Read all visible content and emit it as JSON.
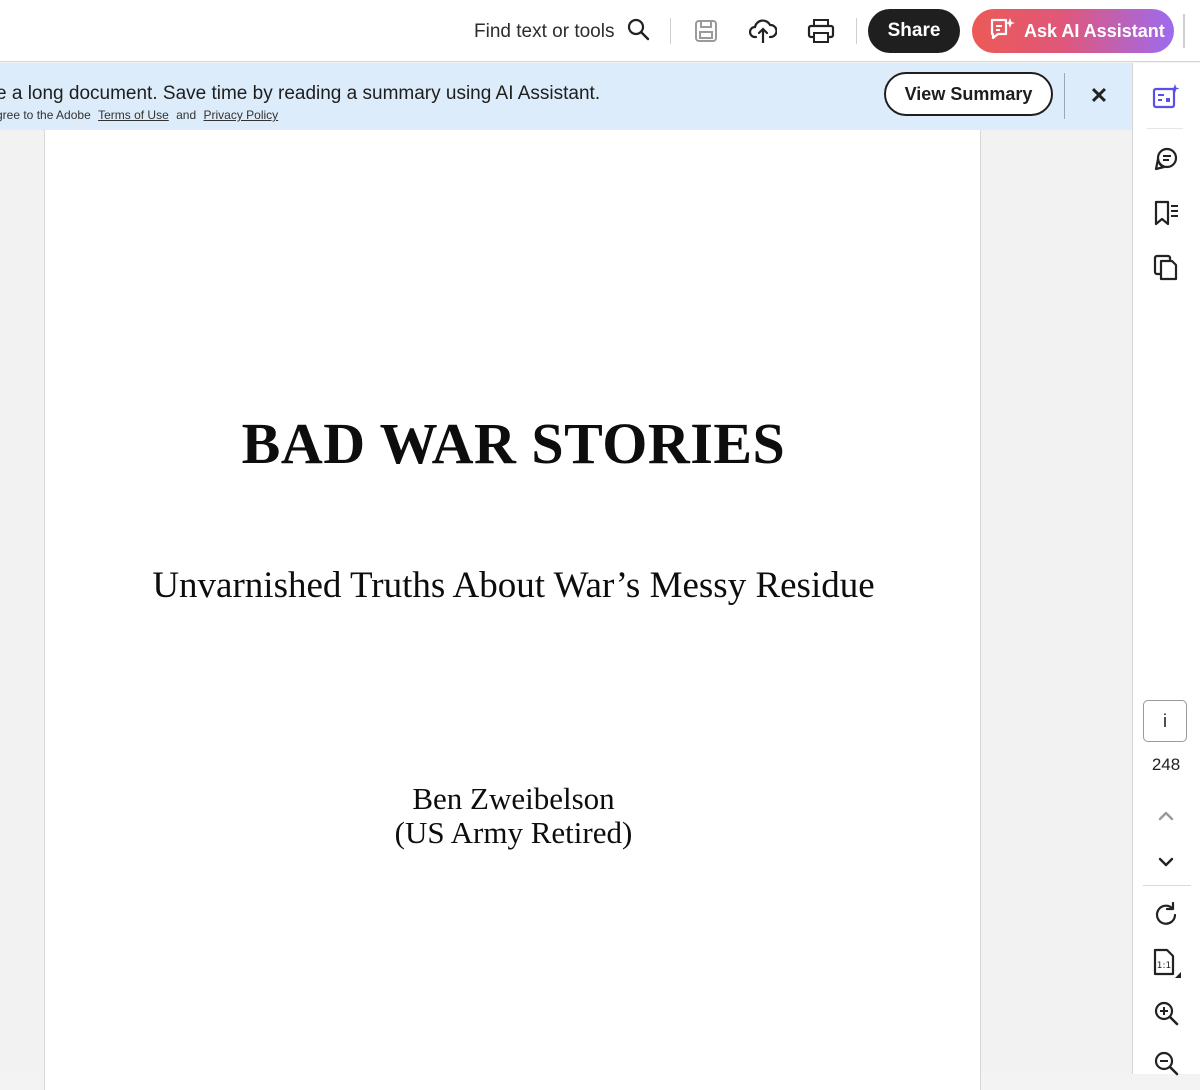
{
  "toolbar": {
    "find_label": "Find text or tools",
    "share_label": "Share",
    "ai_label": "Ask AI Assistant"
  },
  "banner": {
    "message": "e a long document. Save time by reading a summary using AI Assistant.",
    "legal_prefix": "gree to the Adobe",
    "terms_link": "Terms of Use",
    "legal_and": "and",
    "privacy_link": "Privacy Policy",
    "view_summary_label": "View Summary",
    "close_glyph": "✕"
  },
  "document": {
    "title": "BAD WAR STORIES",
    "subtitle": "Unvarnished Truths About War’s Messy Residue",
    "author": "Ben Zweibelson",
    "author_note": "(US Army Retired)"
  },
  "rail": {
    "info_label": "i",
    "page_number": "248"
  },
  "colors": {
    "accent_purple": "#5a4fe6",
    "banner_bg": "#dcecfa",
    "share_bg": "#1f1f1f",
    "ai_gradient_start": "#ec5a56",
    "ai_gradient_end": "#9d6bf0"
  },
  "icons": {
    "toolbar": [
      "search-icon",
      "save-icon",
      "upload-cloud-icon",
      "print-icon",
      "ai-sparkle-icon"
    ],
    "rail": [
      "ai-summary-icon",
      "comment-icon",
      "bookmark-icon",
      "copy-pages-icon",
      "info-icon",
      "chevron-up-icon",
      "chevron-down-icon",
      "rotate-icon",
      "actual-size-icon",
      "zoom-in-icon",
      "zoom-out-icon"
    ]
  }
}
